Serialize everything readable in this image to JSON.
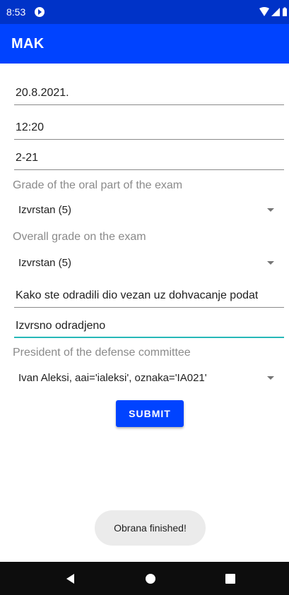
{
  "colors": {
    "primary": "#0043ff",
    "primary_dark": "#0033c8",
    "accent": "#26b8b8",
    "nav_bar": "#0d0d0d",
    "toast_bg": "#ebebeb"
  },
  "status_bar": {
    "time": "8:53",
    "icons": [
      "app-notification-icon",
      "wifi-icon",
      "signal-icon",
      "battery-icon"
    ]
  },
  "app_bar": {
    "title": "MAK"
  },
  "form": {
    "date": "20.8.2021.",
    "time": "12:20",
    "room": "2-21",
    "oral_grade_label": "Grade of the oral part of the exam",
    "oral_grade_value": "Izvrstan (5)",
    "overall_grade_label": "Overall grade on the exam",
    "overall_grade_value": "Izvrstan (5)",
    "question": "Kako ste odradili dio vezan uz dohvacanje podat",
    "answer": "Izvrsno odradjeno",
    "president_label": "President of the defense committee",
    "president_value": "Ivan Aleksi, aai='ialeksi', oznaka='IA021'",
    "submit_label": "SUBMIT"
  },
  "toast": {
    "message": "Obrana finished!"
  },
  "nav_bar": {
    "buttons": [
      "back-icon",
      "home-icon",
      "recents-icon"
    ]
  }
}
